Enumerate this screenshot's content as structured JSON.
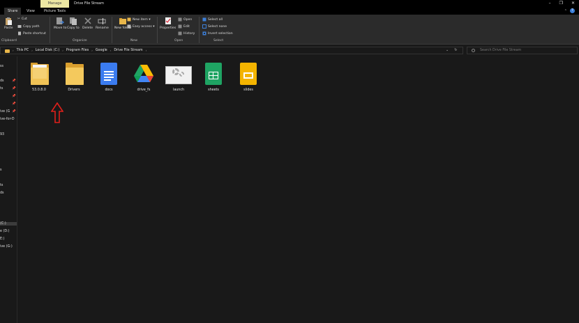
{
  "window": {
    "context_tab": "Manage",
    "title": "Drive File Stream",
    "controls": [
      "–",
      "❐",
      "✕"
    ]
  },
  "tabs": [
    {
      "label": "Share",
      "active": true
    },
    {
      "label": "View",
      "active": false
    },
    {
      "label": "Picture Tools",
      "active": false
    }
  ],
  "ribbon": {
    "clipboard": {
      "paste": "Paste",
      "cut": "Cut",
      "copy_path": "Copy path",
      "paste_shortcut": "Paste shortcut",
      "group": "Clipboard"
    },
    "organize": {
      "move_to": "Move to",
      "copy_to": "Copy to",
      "delete": "Delete",
      "rename": "Rename",
      "group": "Organize"
    },
    "new": {
      "new_folder": "New folder",
      "new_item": "New item ▾",
      "easy_access": "Easy access ▾",
      "group": "New"
    },
    "open": {
      "properties": "Properties",
      "open": "Open",
      "edit": "Edit",
      "history": "History",
      "group": "Open"
    },
    "select": {
      "select_all": "Select all",
      "select_none": "Select none",
      "invert_selection": "Invert selection",
      "group": "Select"
    }
  },
  "address": {
    "crumbs": [
      "This PC",
      "Local Disk (C:)",
      "Program Files",
      "Google",
      "Drive File Stream"
    ],
    "search_placeholder": "Search Drive File Stream"
  },
  "nav": [
    {
      "label": "ss",
      "pinned": false
    },
    {
      "label": "ds",
      "pinned": true
    },
    {
      "label": "ts",
      "pinned": true
    },
    {
      "label": "",
      "pinned": true
    },
    {
      "label": "",
      "pinned": true
    },
    {
      "label": "ive (G",
      "pinned": true
    },
    {
      "label": "ive-for-D",
      "pinned": false
    },
    {
      "label": "93",
      "pinned": false
    },
    {
      "label": "s",
      "pinned": false
    },
    {
      "label": "ts",
      "pinned": false
    },
    {
      "label": "ds",
      "pinned": false
    },
    {
      "label": "(C:)",
      "pinned": false,
      "selected": true
    },
    {
      "label": "e (D:)",
      "pinned": false
    },
    {
      "label": "E:)",
      "pinned": false
    },
    {
      "label": "ive (G:)",
      "pinned": false
    }
  ],
  "files": [
    {
      "name": "53.0.8.0",
      "kind": "folder-with-paper"
    },
    {
      "name": "Drivers",
      "kind": "folder"
    },
    {
      "name": "docs",
      "kind": "google-docs"
    },
    {
      "name": "drive_fs",
      "kind": "google-drive"
    },
    {
      "name": "launch",
      "kind": "app-settings"
    },
    {
      "name": "sheets",
      "kind": "google-sheets"
    },
    {
      "name": "slides",
      "kind": "google-slides"
    }
  ],
  "colors": {
    "manage_tab": "#ede8a3",
    "folder": "#f4c95d",
    "docs": "#3b7cf0",
    "sheets": "#1fa463",
    "slides": "#f4b400",
    "annotation_arrow": "#e0201b"
  }
}
